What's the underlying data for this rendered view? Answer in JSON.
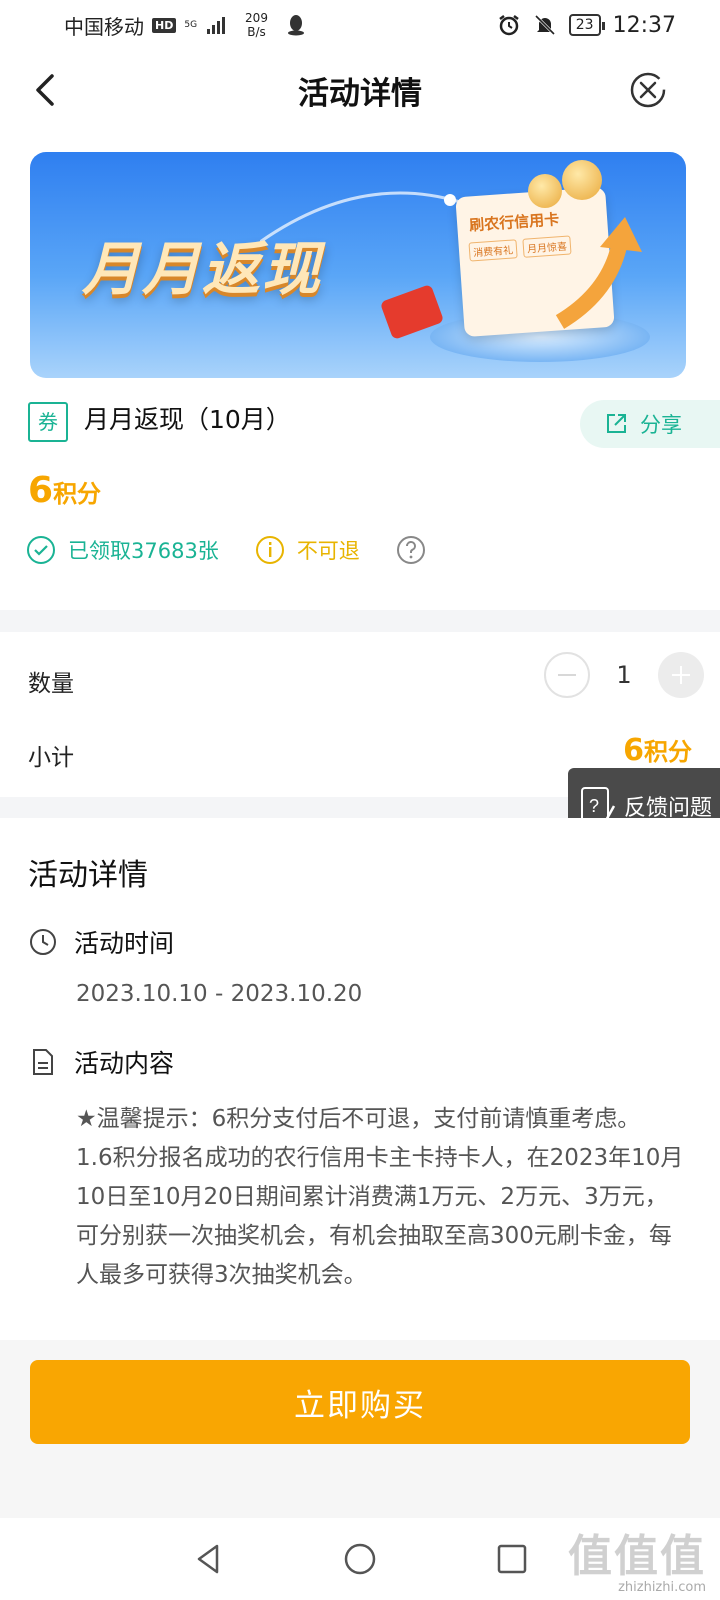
{
  "status_bar": {
    "carrier": "中国移动",
    "hd": "HD",
    "network": "5G",
    "speed_value": "209",
    "speed_unit": "B/s",
    "battery": "23",
    "time": "12:37"
  },
  "nav": {
    "title": "活动详情"
  },
  "banner": {
    "headline": "月月返现",
    "card_title": "刷农行信用卡",
    "card_tags": [
      "消费有礼",
      "月月惊喜"
    ]
  },
  "coupon": {
    "badge": "券",
    "name": "月月返现（10月）",
    "share_label": "分享",
    "price_value": "6",
    "price_unit": "积分",
    "claimed": "已领取37683张",
    "non_refundable": "不可退"
  },
  "order": {
    "quantity_label": "数量",
    "quantity": "1",
    "subtotal_label": "小计",
    "subtotal_value": "6",
    "subtotal_unit": "积分"
  },
  "feedback_label": "反馈问题",
  "details": {
    "title": "活动详情",
    "time_heading": "活动时间",
    "time_range": "2023.10.10 - 2023.10.20",
    "content_heading": "活动内容",
    "content": "★温馨提示：6积分支付后不可退，支付前请慎重考虑。\n1.6积分报名成功的农行信用卡主卡持卡人，在2023年10月10日至10月20日期间累计消费满1万元、2万元、3万元，可分别获一次抽奖机会，有机会抽取至高300元刷卡金，每人最多可获得3次抽奖机会。"
  },
  "buy_button_label": "立即购买",
  "watermark": {
    "big": "值值值",
    "small": "zhizhizhi.com"
  },
  "colors": {
    "accent_green": "#1ab394",
    "accent_orange": "#f7a600",
    "buy_button": "#f9a602",
    "banner_blue": "#2f7ff0"
  }
}
